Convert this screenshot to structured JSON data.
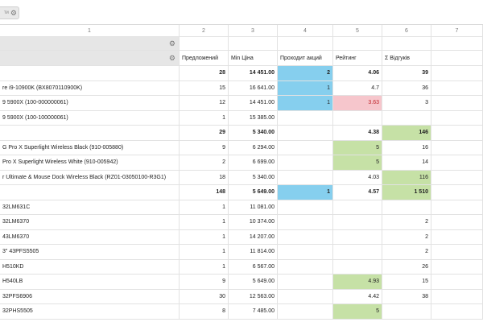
{
  "toolbar": {
    "chip_label": "ти",
    "chip_icon": "gear-icon"
  },
  "column_numbers": [
    "1",
    "2",
    "3",
    "4",
    "5",
    "6",
    "7"
  ],
  "headers": [
    "Предложений",
    "Min Ціна",
    "Проходит акций",
    "Рейтинг",
    "Σ Відгуків"
  ],
  "rows": [
    {
      "label": "",
      "c2": "28",
      "c3": "14 451.00",
      "c4": "2",
      "c5": "4.06",
      "c6": "39",
      "bold": true,
      "h4": "blue",
      "h5": "",
      "h6": ""
    },
    {
      "label": "re i9-10900K (BX8070110900K)",
      "c2": "15",
      "c3": "16 641.00",
      "c4": "1",
      "c5": "4.7",
      "c6": "36",
      "bold": false,
      "h4": "blue",
      "h5": "",
      "h6": ""
    },
    {
      "label": " 9 5900X (100-000000061)",
      "c2": "12",
      "c3": "14 451.00",
      "c4": "1",
      "c5": "3.63",
      "c6": "3",
      "bold": false,
      "h4": "blue",
      "h5": "pink",
      "h6": ""
    },
    {
      "label": " 9 5900X (100-100000061)",
      "c2": "1",
      "c3": "15 385.00",
      "c4": "",
      "c5": "",
      "c6": "",
      "bold": false,
      "h4": "",
      "h5": "",
      "h6": ""
    },
    {
      "label": "",
      "c2": "29",
      "c3": "5 340.00",
      "c4": "",
      "c5": "4.38",
      "c6": "146",
      "bold": true,
      "h4": "",
      "h5": "",
      "h6": "green"
    },
    {
      "label": "G Pro X Superlight Wireless Black (910-005880)",
      "c2": "9",
      "c3": "6 294.00",
      "c4": "",
      "c5": "5",
      "c6": "16",
      "bold": false,
      "h4": "",
      "h5": "green",
      "h6": ""
    },
    {
      "label": " Pro X Superlight Wireless White (910-005942)",
      "c2": "2",
      "c3": "6 699.00",
      "c4": "",
      "c5": "5",
      "c6": "14",
      "bold": false,
      "h4": "",
      "h5": "green",
      "h6": ""
    },
    {
      "label": "r Ultimate & Mouse Dock Wireless Black (RZ01-03050100-R3G1)",
      "c2": "18",
      "c3": "5 340.00",
      "c4": "",
      "c5": "4.03",
      "c6": "116",
      "bold": false,
      "h4": "",
      "h5": "",
      "h6": "green"
    },
    {
      "label": "",
      "c2": "148",
      "c3": "5 649.00",
      "c4": "1",
      "c5": "4.57",
      "c6": "1 510",
      "bold": true,
      "h4": "blue",
      "h5": "",
      "h6": "green"
    },
    {
      "label": "32LM631C",
      "c2": "1",
      "c3": "11 081.00",
      "c4": "",
      "c5": "",
      "c6": "",
      "bold": false,
      "h4": "",
      "h5": "",
      "h6": ""
    },
    {
      "label": "32LM6370",
      "c2": "1",
      "c3": "10 374.00",
      "c4": "",
      "c5": "",
      "c6": "2",
      "bold": false,
      "h4": "",
      "h5": "",
      "h6": ""
    },
    {
      "label": "43LM6370",
      "c2": "1",
      "c3": "14 207.00",
      "c4": "",
      "c5": "",
      "c6": "2",
      "bold": false,
      "h4": "",
      "h5": "",
      "h6": ""
    },
    {
      "label": "3\" 43PFS5505",
      "c2": "1",
      "c3": "11 814.00",
      "c4": "",
      "c5": "",
      "c6": "2",
      "bold": false,
      "h4": "",
      "h5": "",
      "h6": ""
    },
    {
      "label": "H510KD",
      "c2": "1",
      "c3": "6 567.00",
      "c4": "",
      "c5": "",
      "c6": "26",
      "bold": false,
      "h4": "",
      "h5": "",
      "h6": ""
    },
    {
      "label": "H540LB",
      "c2": "9",
      "c3": "5 649.00",
      "c4": "",
      "c5": "4.93",
      "c6": "15",
      "bold": false,
      "h4": "",
      "h5": "green",
      "h6": ""
    },
    {
      "label": "32PFS6906",
      "c2": "30",
      "c3": "12 563.00",
      "c4": "",
      "c5": "4.42",
      "c6": "38",
      "bold": false,
      "h4": "",
      "h5": "",
      "h6": ""
    },
    {
      "label": "32PHS5505",
      "c2": "8",
      "c3": "7 485.00",
      "c4": "",
      "c5": "5",
      "c6": "",
      "bold": false,
      "h4": "",
      "h5": "green",
      "h6": ""
    }
  ],
  "colors": {
    "blue": "#86cfee",
    "green": "#c6e1a6",
    "pink": "#f6c6cc",
    "rating_low": "#c1272d"
  }
}
